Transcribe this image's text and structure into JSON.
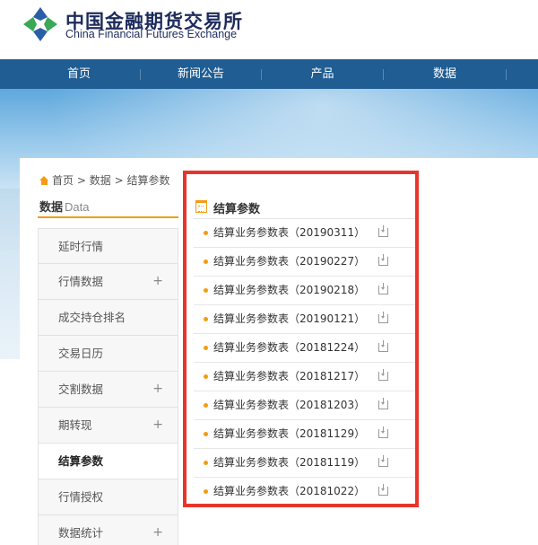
{
  "header": {
    "logo_cn": "中国金融期货交易所",
    "logo_en": "China Financial Futures Exchange"
  },
  "nav": {
    "items": [
      "首页",
      "新闻公告",
      "产品",
      "数据"
    ]
  },
  "breadcrumb": {
    "home": "首页",
    "sep1": ">",
    "level1": "数据",
    "sep2": ">",
    "level2": "结算参数"
  },
  "sidebar": {
    "title": "数据",
    "title_en": "Data",
    "items": [
      {
        "label": "延时行情",
        "expand": ""
      },
      {
        "label": "行情数据",
        "expand": "+"
      },
      {
        "label": "成交持仓排名",
        "expand": ""
      },
      {
        "label": "交易日历",
        "expand": ""
      },
      {
        "label": "交割数据",
        "expand": "+"
      },
      {
        "label": "期转现",
        "expand": "+"
      },
      {
        "label": "结算参数",
        "expand": ""
      },
      {
        "label": "行情授权",
        "expand": ""
      },
      {
        "label": "数据统计",
        "expand": "+"
      }
    ]
  },
  "main": {
    "title": "结算参数",
    "files": [
      "结算业务参数表（20190311）",
      "结算业务参数表（20190227）",
      "结算业务参数表（20190218）",
      "结算业务参数表（20190121）",
      "结算业务参数表（20181224）",
      "结算业务参数表（20181217）",
      "结算业务参数表（20181203）",
      "结算业务参数表（20181129）",
      "结算业务参数表（20181119）",
      "结算业务参数表（20181022）"
    ]
  },
  "colors": {
    "nav_bg": "#1f5d93",
    "accent": "#f39c12",
    "highlight": "#e8352b"
  }
}
